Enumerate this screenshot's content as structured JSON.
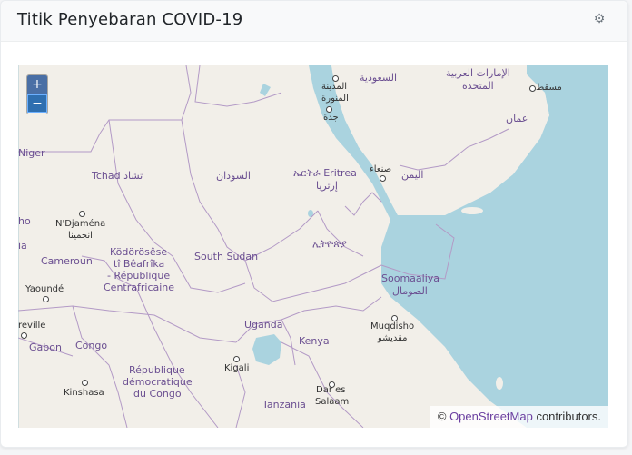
{
  "header": {
    "title": "Titik Penyebaran COVID-19",
    "settings_icon": "gear-icon"
  },
  "map": {
    "zoom_in_label": "+",
    "zoom_out_label": "−",
    "attribution": {
      "prefix": "©",
      "link_text": "OpenStreetMap",
      "suffix": " contributors."
    },
    "countries": [
      {
        "id": "niger",
        "label": "Niger"
      },
      {
        "id": "chad",
        "label": "Tchad تشاد"
      },
      {
        "id": "sudan",
        "label": "السودان"
      },
      {
        "id": "eritrea",
        "label": "ኤርትራ Eritrea"
      },
      {
        "id": "eritrea2",
        "label": "إرتريا"
      },
      {
        "id": "ethiopia",
        "label": "ኢትዮጵያ"
      },
      {
        "id": "saudi",
        "label": "السعودية"
      },
      {
        "id": "uae",
        "label": "الإمارات العربية"
      },
      {
        "id": "uae2",
        "label": "المتحدة"
      },
      {
        "id": "oman",
        "label": "عمان"
      },
      {
        "id": "yemen",
        "label": "اليمن"
      },
      {
        "id": "somalia",
        "label": "Soomaaliya"
      },
      {
        "id": "somalia2",
        "label": "الصومال"
      },
      {
        "id": "southsudan",
        "label": "South Sudan"
      },
      {
        "id": "car1",
        "label": "Ködörösêse"
      },
      {
        "id": "car2",
        "label": "tî Bêafrîka"
      },
      {
        "id": "car3",
        "label": "- République"
      },
      {
        "id": "car4",
        "label": "Centrafricaine"
      },
      {
        "id": "cameroon",
        "label": "Cameroun"
      },
      {
        "id": "gabon",
        "label": "Gabon"
      },
      {
        "id": "congo",
        "label": "Congo"
      },
      {
        "id": "drc1",
        "label": "République"
      },
      {
        "id": "drc2",
        "label": "démocratique"
      },
      {
        "id": "drc3",
        "label": "du Congo"
      },
      {
        "id": "uganda",
        "label": "Uganda"
      },
      {
        "id": "kenya",
        "label": "Kenya"
      },
      {
        "id": "tanzania",
        "label": "Tanzania"
      },
      {
        "id": "ho",
        "label": "ho"
      },
      {
        "id": "ia",
        "label": "ia"
      }
    ],
    "cities": [
      {
        "id": "medina1",
        "label": "المدينة"
      },
      {
        "id": "medina2",
        "label": "المنورة"
      },
      {
        "id": "jeddah",
        "label": "جدة"
      },
      {
        "id": "sanaa",
        "label": "صنعاء"
      },
      {
        "id": "muscat",
        "label": "مسقط"
      },
      {
        "id": "ndjamena1",
        "label": "N'Djaména"
      },
      {
        "id": "ndjamena2",
        "label": "انجمينا"
      },
      {
        "id": "yaounde",
        "label": "Yaoundé"
      },
      {
        "id": "mogadishu1",
        "label": "Muqdisho"
      },
      {
        "id": "mogadishu2",
        "label": "مقديشو"
      },
      {
        "id": "kigali",
        "label": "Kigali"
      },
      {
        "id": "kinshasa",
        "label": "Kinshasa"
      },
      {
        "id": "dar1",
        "label": "Dar es"
      },
      {
        "id": "dar2",
        "label": "Salaam"
      },
      {
        "id": "libreville",
        "label": "reville"
      }
    ]
  }
}
